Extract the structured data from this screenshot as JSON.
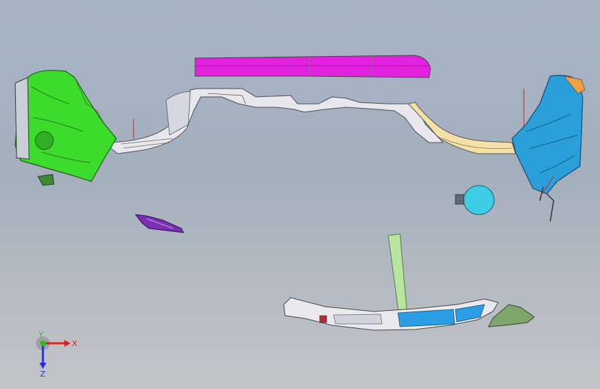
{
  "viewport": {
    "background_top": "#a8b5c7",
    "background_bottom": "#c3c5c7"
  },
  "parts": [
    {
      "name": "left-fender",
      "color": "#3ddc2c"
    },
    {
      "name": "top-spoiler",
      "color": "#e322e0"
    },
    {
      "name": "rear-bumper-frame",
      "color": "#e8e8ec"
    },
    {
      "name": "right-fender",
      "color": "#2b9fd9"
    },
    {
      "name": "bumper-lower-panel",
      "color": "#f3e1a8"
    },
    {
      "name": "fuel-door",
      "color": "#3fcde5"
    },
    {
      "name": "left-bracket",
      "color": "#7a2fb4"
    },
    {
      "name": "vertical-strip",
      "color": "#b8e6a0"
    },
    {
      "name": "lower-valance",
      "color": "#e9e9ee"
    },
    {
      "name": "lower-right-bracket",
      "color": "#7fa66a"
    }
  ],
  "triad": {
    "x_label": "X",
    "y_label": "Y",
    "z_label": "Z",
    "x_color": "#e02020",
    "y_color": "#20c020",
    "z_color": "#2030e0"
  }
}
